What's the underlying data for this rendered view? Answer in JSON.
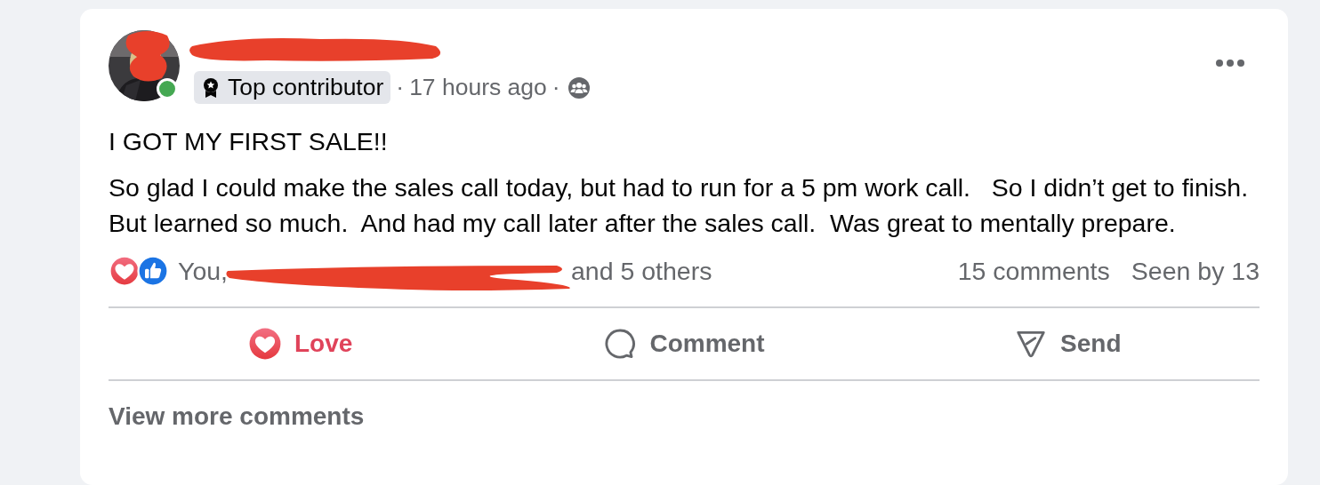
{
  "post": {
    "author": {
      "online": true
    },
    "meta": [
      {
        "kind": "badge",
        "text": "Top contributor"
      },
      {
        "kind": "sep",
        "text": "·"
      },
      {
        "kind": "time",
        "text": "17 hours ago"
      },
      {
        "kind": "sep",
        "text": "·"
      },
      {
        "kind": "audience"
      }
    ],
    "body": [
      "I GOT MY FIRST SALE!!",
      "So glad I could make the sales call today, but had to run for a 5 pm work call.   So I didn’t get to finish.  But learned so much.  And had my call later after the sales call.  Was great to mentally prepare."
    ],
    "reactions": {
      "icons": [
        {
          "kind": "love"
        },
        {
          "kind": "like"
        }
      ],
      "names_start": "You,",
      "names_end": "and 5 others"
    },
    "comments_count": "15 comments",
    "seen": "Seen by 13",
    "actions": [
      {
        "kind": "love",
        "label": "Love",
        "selected": true
      },
      {
        "kind": "comment",
        "label": "Comment",
        "selected": false
      },
      {
        "kind": "send",
        "label": "Send",
        "selected": false
      }
    ],
    "view_more": "View more comments"
  }
}
